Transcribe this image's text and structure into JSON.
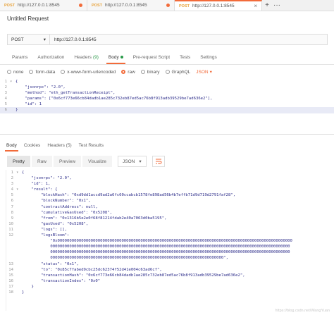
{
  "tabs": [
    {
      "method": "POST",
      "url": "http://127.0.0.1:8545",
      "active": false
    },
    {
      "method": "POST",
      "url": "http://127.0.0.1:8545",
      "active": false
    },
    {
      "method": "POST",
      "url": "http://127.0.0.1:8545",
      "active": true
    }
  ],
  "request": {
    "title": "Untitled Request",
    "method": "POST",
    "url": "http://127.0.0.1:8545"
  },
  "req_tabs": {
    "params": "Params",
    "authorization": "Authorization",
    "headers": "Headers",
    "headers_count": "(9)",
    "body": "Body",
    "prerequest": "Pre-request Script",
    "tests": "Tests",
    "settings": "Settings"
  },
  "body_types": {
    "none": "none",
    "form_data": "form-data",
    "urlencoded": "x-www-form-urlencoded",
    "raw": "raw",
    "binary": "binary",
    "graphql": "GraphQL",
    "format": "JSON"
  },
  "request_body": [
    {
      "n": "1",
      "t": "{"
    },
    {
      "n": "2",
      "t": "    \"jsonrpc\": \"2.0\","
    },
    {
      "n": "3",
      "t": "    \"method\": \"eth_getTransactionReceipt\","
    },
    {
      "n": "4",
      "t": "    \"params\": [\"0x6cf773e66cb84dadb1ae285c732eb87ed5ac76b8f913adb39529be7ad636e2\"],"
    },
    {
      "n": "5",
      "t": "    \"id\": 1"
    },
    {
      "n": "6",
      "t": "}"
    }
  ],
  "res_tabs": {
    "body": "Body",
    "cookies": "Cookies",
    "headers": "Headers (5)",
    "test_results": "Test Results"
  },
  "res_toolbar": {
    "pretty": "Pretty",
    "raw": "Raw",
    "preview": "Preview",
    "visualize": "Visualize",
    "format": "JSON"
  },
  "response_body": [
    {
      "n": "1",
      "t": "{"
    },
    {
      "n": "2",
      "t": "    \"jsonrpc\": \"2.0\","
    },
    {
      "n": "3",
      "t": "    \"id\": 1,"
    },
    {
      "n": "4",
      "t": "    \"result\": {"
    },
    {
      "n": "5",
      "t": "        \"blockHash\": \"0xd9dd1accd9ad2a6fc60ccabcb1578fe898ad56b4b7effb71d9d719d2791faf28\","
    },
    {
      "n": "6",
      "t": "        \"blockNumber\": \"0x1\","
    },
    {
      "n": "7",
      "t": "        \"contractAddress\": null,"
    },
    {
      "n": "8",
      "t": "        \"cumulativeGasUsed\": \"0x5208\","
    },
    {
      "n": "9",
      "t": "        \"from\": \"0x1316b5e2e0f68f81214fdab2e40a7063d0ba5195\","
    },
    {
      "n": "10",
      "t": "        \"gasUsed\": \"0x5208\","
    },
    {
      "n": "11",
      "t": "        \"logs\": [],"
    },
    {
      "n": "12",
      "t": "        \"logsBloom\":"
    },
    {
      "n": "",
      "t": "            \"0x000000000000000000000000000000000000000000000000000000000000000000000000000000000000000000000000000"
    },
    {
      "n": "",
      "t": "            00000000000000000000000000000000000000000000000000000000000000000000000000000000000000000000000000000"
    },
    {
      "n": "",
      "t": "            00000000000000000000000000000000000000000000000000000000000000000000000000000000000000000000000000000"
    },
    {
      "n": "",
      "t": "            0000000000000000000000000000000000000000000000000000000000000000000000000\","
    },
    {
      "n": "13",
      "t": "        \"status\": \"0x1\","
    },
    {
      "n": "14",
      "t": "        \"to\": \"0x85c7fabed9cbc25dc62374f52d41e004c63ad6cf\","
    },
    {
      "n": "15",
      "t": "        \"transactionHash\": \"0x6cf773e66cb84dadb1ae285c732eb87ed5ac76b8f913adb39529be7ad636e2\","
    },
    {
      "n": "16",
      "t": "        \"transactionIndex\": \"0x0\""
    },
    {
      "n": "17",
      "t": "    }"
    },
    {
      "n": "18",
      "t": "}"
    }
  ],
  "watermark": "https://blog.csdn.net/WangYuan",
  "colors": {
    "accent": "#f26b3a",
    "success": "#2a9a4a",
    "code": "#2d2d8a"
  }
}
